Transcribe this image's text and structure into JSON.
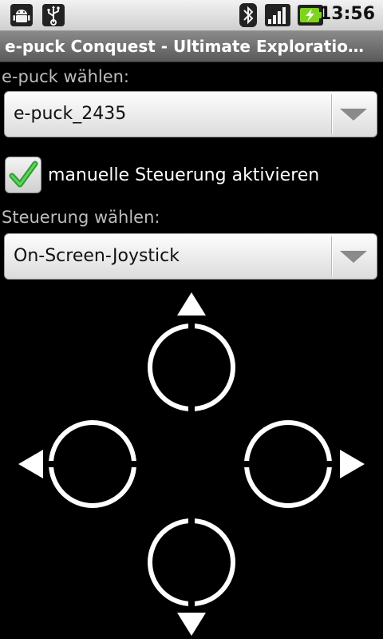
{
  "status_bar": {
    "time": "13:56",
    "icons": [
      "android-debug-icon",
      "usb-icon",
      "bluetooth-icon",
      "signal-icon",
      "battery-charging-icon"
    ]
  },
  "app": {
    "title": "e-puck Conquest - Ultimate Exploration Experience"
  },
  "robot_select": {
    "label": "e-puck wählen:",
    "selected": "e-puck_2435"
  },
  "manual_control": {
    "label": "manuelle Steuerung aktivieren",
    "checked": true
  },
  "control_select": {
    "label": "Steuerung wählen:",
    "selected": "On-Screen-Joystick"
  },
  "joystick": {
    "buttons": [
      "up",
      "left",
      "right",
      "down"
    ]
  },
  "colors": {
    "background": "#000000",
    "check_green": "#3cb83c"
  }
}
